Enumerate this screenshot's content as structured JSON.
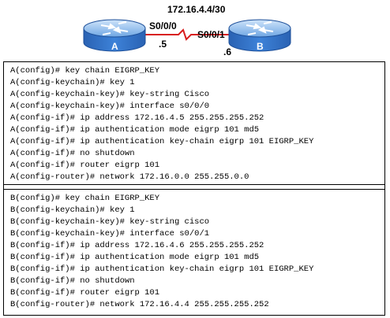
{
  "topology": {
    "network": "172.16.4.4/30",
    "router_a": {
      "name": "A",
      "interface": "S0/0/0",
      "host": ".5"
    },
    "router_b": {
      "name": "B",
      "interface": "S0/0/1",
      "host": ".6"
    },
    "colors": {
      "router_body": "#3b7fd6",
      "router_top": "#9cc6f0",
      "link": "#d81e1e"
    }
  },
  "config_a": [
    {
      "prompt": "A(config)# ",
      "cmd": "key chain EIGRP_KEY"
    },
    {
      "prompt": "A(config-keychain)# ",
      "cmd": "key 1"
    },
    {
      "prompt": "A(config-keychain-key)# ",
      "cmd": "key-string Cisco"
    },
    {
      "prompt": "A(config-keychain-key)# ",
      "cmd": "interface s0/0/0"
    },
    {
      "prompt": "A(config-if)# ",
      "cmd": "ip address 172.16.4.5 255.255.255.252"
    },
    {
      "prompt": "A(config-if)# ",
      "cmd": "ip authentication mode eigrp 101 md5"
    },
    {
      "prompt": "A(config-if)# ",
      "cmd": "ip authentication key-chain eigrp 101 EIGRP_KEY"
    },
    {
      "prompt": "A(config-if)# ",
      "cmd": "no shutdown"
    },
    {
      "prompt": "A(config-if)# ",
      "cmd": "router eigrp 101"
    },
    {
      "prompt": "A(config-router)# ",
      "cmd": "network 172.16.0.0 255.255.0.0"
    }
  ],
  "config_b": [
    {
      "prompt": "B(config)# ",
      "cmd": "key chain EIGRP_KEY"
    },
    {
      "prompt": "B(config-keychain)# ",
      "cmd": "key 1"
    },
    {
      "prompt": "B(config-keychain-key)# ",
      "cmd": "key-string cisco"
    },
    {
      "prompt": "B(config-keychain-key)# ",
      "cmd": "interface s0/0/1"
    },
    {
      "prompt": "B(config-if)# ",
      "cmd": "ip address 172.16.4.6 255.255.255.252"
    },
    {
      "prompt": "B(config-if)# ",
      "cmd": "ip authentication mode eigrp 101 md5"
    },
    {
      "prompt": "B(config-if)# ",
      "cmd": "ip authentication key-chain eigrp 101 EIGRP_KEY"
    },
    {
      "prompt": "B(config-if)# ",
      "cmd": "no shutdown"
    },
    {
      "prompt": "B(config-if)# ",
      "cmd": "router eigrp 101"
    },
    {
      "prompt": "B(config-router)# ",
      "cmd": "network 172.16.4.4 255.255.255.252"
    }
  ]
}
